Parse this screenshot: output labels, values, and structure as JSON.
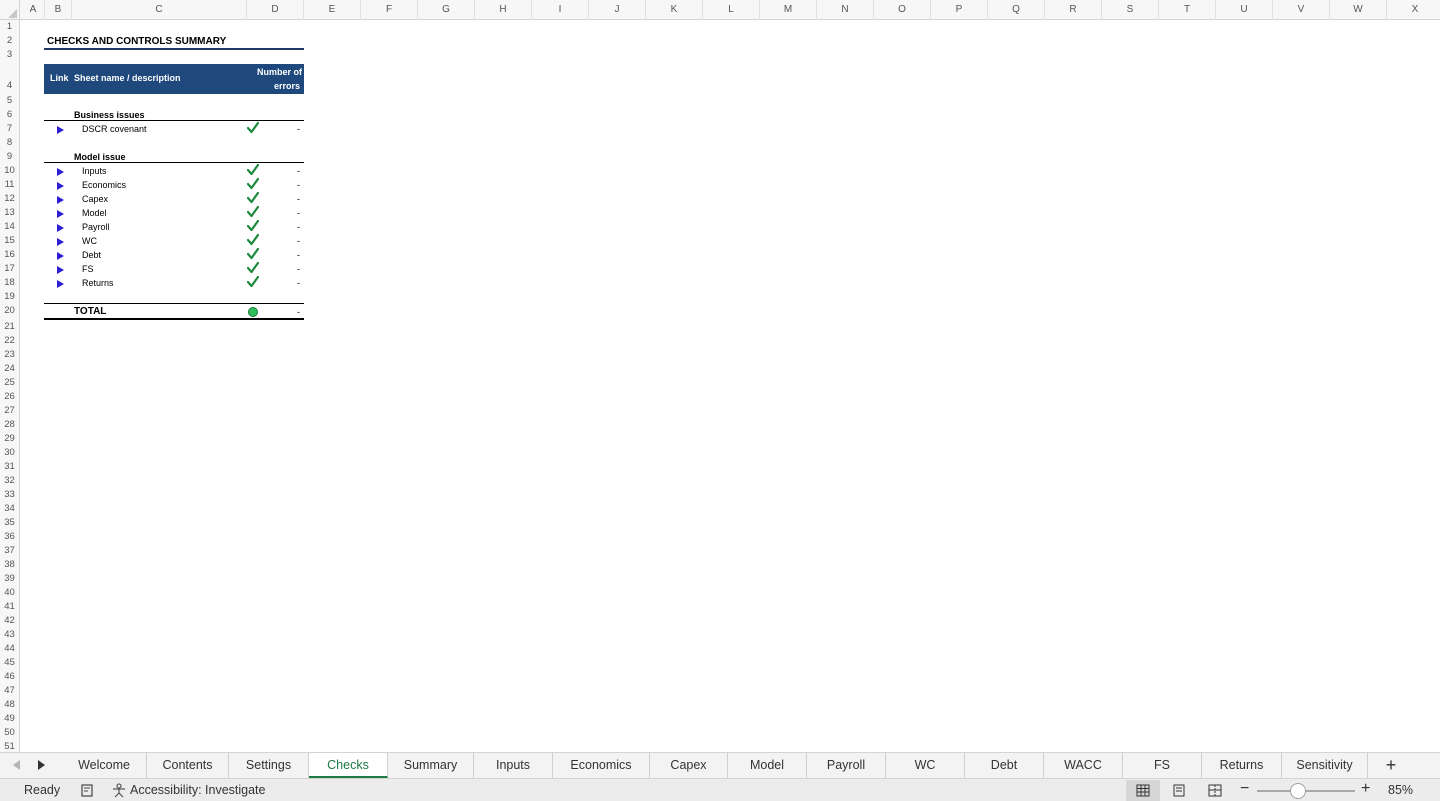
{
  "columns": [
    "A",
    "B",
    "C",
    "D",
    "E",
    "F",
    "G",
    "H",
    "I",
    "J",
    "K",
    "L",
    "M",
    "N",
    "O",
    "P",
    "Q",
    "R",
    "S",
    "T",
    "U",
    "V",
    "W",
    "X"
  ],
  "rows": [
    "1",
    "2",
    "3",
    "4",
    "5",
    "6",
    "7",
    "8",
    "9",
    "10",
    "11",
    "12",
    "13",
    "14",
    "15",
    "16",
    "17",
    "18",
    "19",
    "20",
    "21",
    "22",
    "23",
    "24",
    "25",
    "26",
    "27",
    "28",
    "29",
    "30",
    "31",
    "32",
    "33",
    "34",
    "35",
    "36",
    "37",
    "38",
    "39",
    "40",
    "41",
    "42",
    "43",
    "44",
    "45",
    "46",
    "47",
    "48",
    "49",
    "50",
    "51"
  ],
  "sheet": {
    "title": "CHECKS AND CONTROLS SUMMARY",
    "header": {
      "link": "Link",
      "description": "Sheet name / description",
      "errors_line1": "Number of",
      "errors_line2": "errors"
    },
    "business_section": "Business issues",
    "business_items": [
      {
        "name": "DSCR covenant",
        "errors": "-"
      }
    ],
    "model_section": "Model issue",
    "model_items": [
      {
        "name": "Inputs",
        "errors": "-"
      },
      {
        "name": "Economics",
        "errors": "-"
      },
      {
        "name": "Capex",
        "errors": "-"
      },
      {
        "name": "Model",
        "errors": "-"
      },
      {
        "name": "Payroll",
        "errors": "-"
      },
      {
        "name": "WC",
        "errors": "-"
      },
      {
        "name": "Debt",
        "errors": "-"
      },
      {
        "name": "FS",
        "errors": "-"
      },
      {
        "name": "Returns",
        "errors": "-"
      }
    ],
    "total_label": "TOTAL",
    "total_errors": "-"
  },
  "tabs": [
    "Welcome",
    "Contents",
    "Settings",
    "Checks",
    "Summary",
    "Inputs",
    "Economics",
    "Capex",
    "Model",
    "Payroll",
    "WC",
    "Debt",
    "WACC",
    "FS",
    "Returns",
    "Sensitivity"
  ],
  "active_tab": "Checks",
  "add_tab_label": "+",
  "status": {
    "ready": "Ready",
    "accessibility": "Accessibility: Investigate",
    "zoom_minus": "−",
    "zoom_plus": "+",
    "zoom": "85%"
  },
  "colors": {
    "accent": "#1e7b45",
    "header_band": "#1f497d",
    "check": "#1e8a3c",
    "link_arrow": "#2a1fd6"
  }
}
